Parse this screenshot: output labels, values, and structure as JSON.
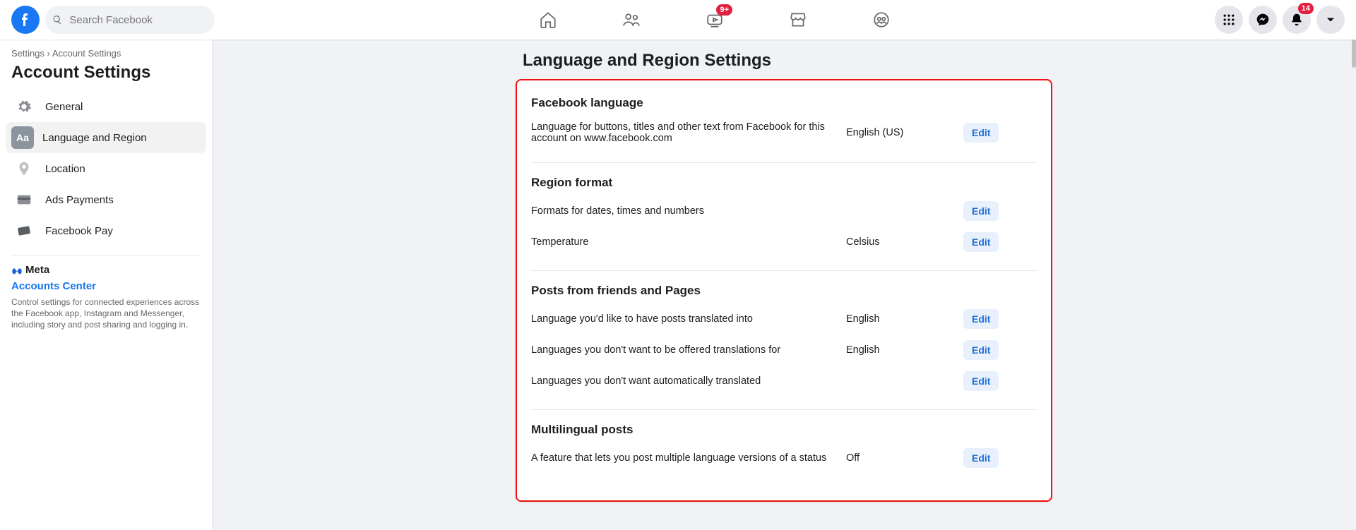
{
  "search": {
    "placeholder": "Search Facebook"
  },
  "topnav": {
    "watch_badge": "9+",
    "notif_badge": "14"
  },
  "breadcrumb": {
    "root": "Settings",
    "sep": "›",
    "leaf": "Account Settings"
  },
  "sidebar": {
    "title": "Account Settings",
    "items": [
      {
        "label": "General"
      },
      {
        "label": "Language and Region"
      },
      {
        "label": "Location"
      },
      {
        "label": "Ads Payments"
      },
      {
        "label": "Facebook Pay"
      }
    ],
    "meta_brand": "Meta",
    "accounts_center": "Accounts Center",
    "meta_desc": "Control settings for connected experiences across the Facebook app, Instagram and Messenger, including story and post sharing and logging in."
  },
  "main": {
    "title": "Language and Region Settings",
    "edit_label": "Edit",
    "sections": [
      {
        "heading": "Facebook language",
        "rows": [
          {
            "desc": "Language for buttons, titles and other text from Facebook for this account on www.facebook.com",
            "value": "English (US)"
          }
        ]
      },
      {
        "heading": "Region format",
        "rows": [
          {
            "desc": "Formats for dates, times and numbers",
            "value": ""
          },
          {
            "desc": "Temperature",
            "value": "Celsius"
          }
        ]
      },
      {
        "heading": "Posts from friends and Pages",
        "rows": [
          {
            "desc": "Language you'd like to have posts translated into",
            "value": "English"
          },
          {
            "desc": "Languages you don't want to be offered translations for",
            "value": "English"
          },
          {
            "desc": "Languages you don't want automatically translated",
            "value": ""
          }
        ]
      },
      {
        "heading": "Multilingual posts",
        "rows": [
          {
            "desc": "A feature that lets you post multiple language versions of a status",
            "value": "Off"
          }
        ]
      }
    ]
  }
}
